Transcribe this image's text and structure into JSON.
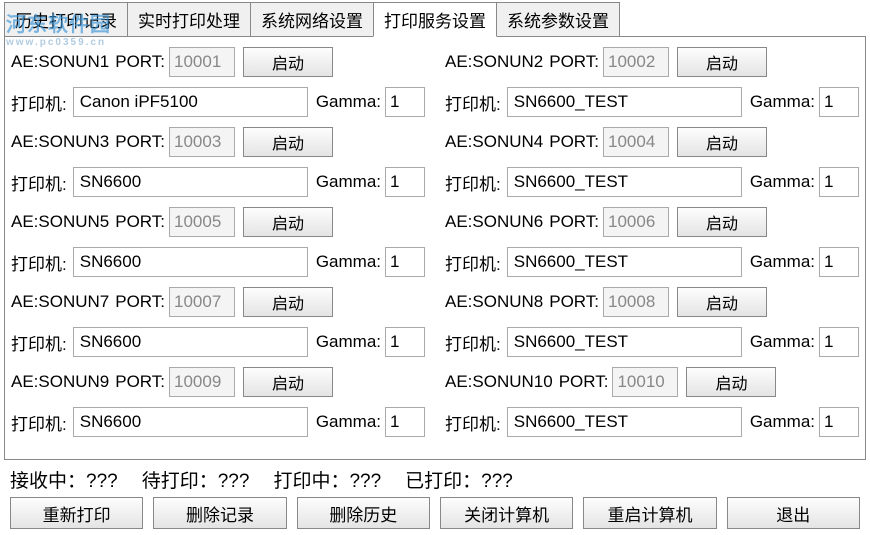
{
  "watermark": {
    "title": "河东软件园",
    "sub": "www.pc0359.cn"
  },
  "tabs": [
    "历史打印记录",
    "实时打印处理",
    "系统网络设置",
    "打印服务设置",
    "系统参数设置"
  ],
  "activeTab": 3,
  "labels": {
    "ae": "AE:",
    "port": "PORT:",
    "printer": "打印机:",
    "gamma": "Gamma:",
    "start": "启动"
  },
  "services": [
    {
      "ae": "SONUN1",
      "port": "10001",
      "printer": "Canon iPF5100",
      "gamma": "1"
    },
    {
      "ae": "SONUN2",
      "port": "10002",
      "printer": "SN6600_TEST",
      "gamma": "1"
    },
    {
      "ae": "SONUN3",
      "port": "10003",
      "printer": "SN6600",
      "gamma": "1"
    },
    {
      "ae": "SONUN4",
      "port": "10004",
      "printer": "SN6600_TEST",
      "gamma": "1"
    },
    {
      "ae": "SONUN5",
      "port": "10005",
      "printer": "SN6600",
      "gamma": "1"
    },
    {
      "ae": "SONUN6",
      "port": "10006",
      "printer": "SN6600_TEST",
      "gamma": "1"
    },
    {
      "ae": "SONUN7",
      "port": "10007",
      "printer": "SN6600",
      "gamma": "1"
    },
    {
      "ae": "SONUN8",
      "port": "10008",
      "printer": "SN6600_TEST",
      "gamma": "1"
    },
    {
      "ae": "SONUN9",
      "port": "10009",
      "printer": "SN6600",
      "gamma": "1"
    },
    {
      "ae": "SONUN10",
      "port": "10010",
      "printer": "SN6600_TEST",
      "gamma": "1"
    }
  ],
  "status": {
    "receiving": {
      "label": "接收中：",
      "value": "???"
    },
    "pending": {
      "label": "待打印：",
      "value": "???"
    },
    "printing": {
      "label": "打印中：",
      "value": "???"
    },
    "printed": {
      "label": "已打印：",
      "value": "???"
    }
  },
  "buttons": {
    "reprint": "重新打印",
    "delRecord": "删除记录",
    "delHistory": "删除历史",
    "shutdown": "关闭计算机",
    "restart": "重启计算机",
    "exit": "退出"
  }
}
